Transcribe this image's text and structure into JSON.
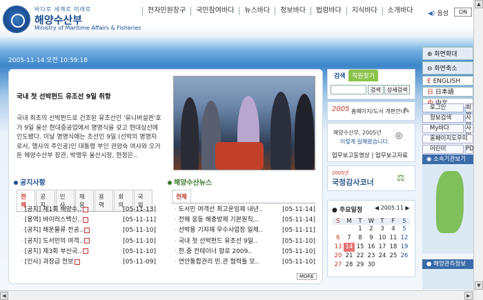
{
  "header": {
    "slogan": "바다로 세계로 미래로",
    "ministry_ko": "해양수산부",
    "ministry_en": "Ministry of Maritime Affairs & Fisheries",
    "gnb": [
      "전자민원창구",
      "국민참여바다",
      "뉴스바다",
      "정보바다",
      "법령바다",
      "지식바다",
      "소개바다"
    ],
    "voice_label": "음성",
    "on_label": "ON",
    "clock": "2005-11-14 오전 10:59:18"
  },
  "headline": {
    "title": "국내 첫 선박펀드 유조선 9일 취항",
    "body": "국내 최초의 선박펀드로 건조된 유조선인 '유니버설퀸'호가 9일 울산 현대중공업에서 명명식을 갖고 현대상선에 인도됐다. 이날 명명식에는 조선인 9일 (선박의 명명자로서, 행사의 주인공)인 대통령 부인 권양숙 여사와 오거돈 해양수산부 장관, 박맹우 울산시장, 현정은.."
  },
  "notice": {
    "title": "공지사항",
    "tabs": [
      "전체",
      "공지",
      "인사",
      "채용",
      "용역",
      "회의",
      "국회"
    ],
    "items": [
      {
        "title": "[공지] 제1회 해양수..",
        "date": "[05-11-13]"
      },
      {
        "title": "[용역] 바이러스백신..",
        "date": "[05-11-11]"
      },
      {
        "title": "[공지] 해운물류 전공..",
        "date": "[05-11-10]"
      },
      {
        "title": "[공지] 도서민의 여객..",
        "date": "[05-11-10]"
      },
      {
        "title": "[공지] 제3회 부산국..",
        "date": "[05-11-10]"
      },
      {
        "title": "[인사] 과장급 전보",
        "date": "[05-11-09]"
      }
    ]
  },
  "ocean_news": {
    "title": "해양수산뉴스",
    "tabs": [
      "전체"
    ],
    "items": [
      {
        "title": "도서민 여객선 최고운임제 내년..",
        "date": "[05-11-14]"
      },
      {
        "title": "전해 응동 해충방제 기본원칙,..",
        "date": "[05-11-14]"
      },
      {
        "title": "선박용 기자재 우수사업장 일체..",
        "date": "[05-11-11]"
      },
      {
        "title": "국내 첫 선박펀드 유조선 9일..",
        "date": "[05-11-10]"
      },
      {
        "title": "한.중 컨테이너 항로 2009..",
        "date": "[05-11-10]"
      },
      {
        "title": "연안통합관리 민.관 협력틀 모..",
        "date": "[05-11-10]"
      }
    ],
    "more_label": "MORE"
  },
  "search": {
    "tab_search": "검색",
    "tab_staff": "직원찾기",
    "search_btn": "검색",
    "detail_btn": "상세검색"
  },
  "cards": {
    "renewal_year": "2005",
    "renewal_text": "홈페이지/도서 개편안내",
    "report_title": "해양수산부, 2005년",
    "report_sub": "이렇게 일해왔습니다.",
    "report_links": "업무보고동영상 | 업무보고자료",
    "audit_year": "2005년",
    "audit_text": "국정감사코너"
  },
  "calendar": {
    "title": "주요일정",
    "month": "2005.11",
    "days": [
      "S",
      "M",
      "T",
      "W",
      "T",
      "F",
      "S"
    ],
    "weeks": [
      [
        "",
        "",
        "1",
        "2",
        "3",
        "4",
        "5"
      ],
      [
        "6",
        "7",
        "8",
        "9",
        "10",
        "11",
        "12"
      ],
      [
        "13",
        "14",
        "15",
        "16",
        "17",
        "18",
        "19"
      ],
      [
        "20",
        "21",
        "22",
        "23",
        "24",
        "25",
        "26"
      ],
      [
        "27",
        "28",
        "29",
        "30",
        "",
        "",
        ""
      ]
    ],
    "today": "14"
  },
  "side": {
    "zoom_in": "화면확대",
    "zoom_out": "화면축소",
    "langs": [
      {
        "prefix": "E",
        "label": "ENGLISH"
      },
      {
        "prefix": "日",
        "label": "日本語"
      },
      {
        "prefix": "中",
        "label": "中文"
      }
    ],
    "quick": [
      [
        "로그인",
        "회원"
      ],
      [
        "정보검색",
        "사이"
      ],
      [
        "My바다",
        "사이"
      ],
      [
        "홈페이지도우미",
        ""
      ],
      [
        "어린이",
        "PDA"
      ]
    ],
    "agency_label": "소속기관보기",
    "ocean_info_label": "해양관측정보"
  },
  "colors": {
    "brand_blue": "#1c4f93",
    "accent_red": "#c03020",
    "news_green": "#3a7a2a"
  }
}
